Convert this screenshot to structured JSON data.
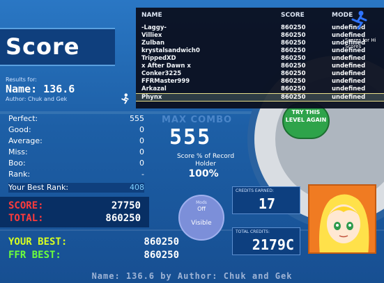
{
  "results": {
    "header_title": "Score",
    "results_for_label": "Results for:",
    "name_line": "Name: 136.6",
    "author_line": "Author: Chuk and Gek"
  },
  "stats": [
    {
      "label": "Perfect:",
      "value": "555"
    },
    {
      "label": "Good:",
      "value": "0"
    },
    {
      "label": "Average:",
      "value": "0"
    },
    {
      "label": "Miss:",
      "value": "0"
    },
    {
      "label": "Boo:",
      "value": "0"
    },
    {
      "label": "Rank:",
      "value": "-"
    }
  ],
  "best_rank": {
    "label": "Your Best Rank:",
    "value": "408"
  },
  "score_block": {
    "score_label": "SCORE:",
    "score_value": "27750",
    "total_label": "TOTAL:",
    "total_value": "860250"
  },
  "best_block": {
    "your_best_label": "YOUR BEST:",
    "your_best_value": "860250",
    "ffr_best_label": "FFR BEST:",
    "ffr_best_value": "860250"
  },
  "combo": {
    "label": "MAX COMBO",
    "value": "555",
    "pct_label": "Score % of Record Holder",
    "pct_value": "100%"
  },
  "mod_circle": {
    "title": "Mods",
    "mods": "Off",
    "visible": "Visible"
  },
  "try_again": "TRY THIS LEVEL AGAIN",
  "credits": {
    "earned_label": "CREDITS EARNED:",
    "earned_value": "17",
    "total_label": "TOTAL CREDITS:",
    "total_value": "2179C"
  },
  "footer": "Name: 136.6 by Author: Chuk and Gek",
  "leaderboard": {
    "headers": {
      "name": "NAME",
      "score": "SCORE",
      "mode": "MODE"
    },
    "rows": [
      {
        "name": "-Laggy-",
        "score": "860250",
        "mode": "undefined"
      },
      {
        "name": "Villiex",
        "score": "860250",
        "mode": "undefined"
      },
      {
        "name": "Zulban",
        "score": "860250",
        "mode": "undefined"
      },
      {
        "name": "krystalsandwich0",
        "score": "860250",
        "mode": "undefined"
      },
      {
        "name": "TrippedXD",
        "score": "860250",
        "mode": "undefined"
      },
      {
        "name": "x After Dawn x",
        "score": "860250",
        "mode": "undefined"
      },
      {
        "name": "Conker3225",
        "score": "860250",
        "mode": "undefined"
      },
      {
        "name": "FFRMaster999",
        "score": "860250",
        "mode": "undefined"
      },
      {
        "name": "Arkazal",
        "score": "860250",
        "mode": "undefined"
      },
      {
        "name": "Phynx",
        "score": "860250",
        "mode": "undefined"
      }
    ],
    "highlighted_index": 9,
    "side_note": "Scores for Hi Scores"
  },
  "colors": {
    "background": "#1d5fa6",
    "score_label": "#ff3b3b",
    "total_label": "#ff3b3b",
    "your_best_label": "#d7ff22",
    "ffr_best_label": "#6cff3a",
    "try_again_button": "#2ea34a",
    "highlight_border": "#f0e58a"
  },
  "icons": [
    "runner-icon",
    "small-runner-icon",
    "character-portrait"
  ]
}
